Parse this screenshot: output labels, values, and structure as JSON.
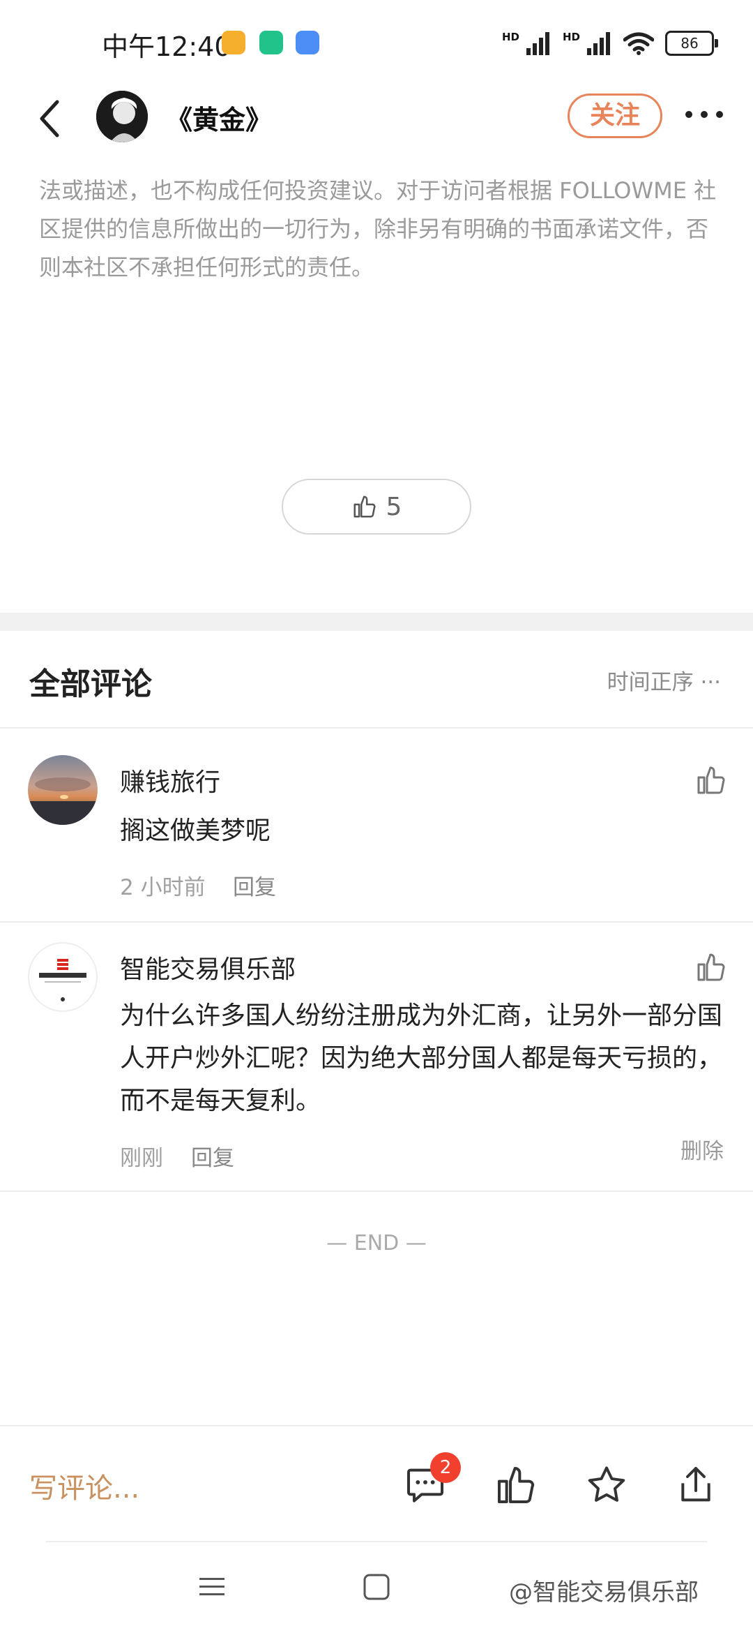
{
  "status_bar": {
    "time": "中午12:40",
    "hd_1": "HD",
    "hd_2": "HD",
    "battery": "86"
  },
  "header": {
    "title": "《黄金》",
    "follow_label": "关注"
  },
  "article": {
    "disclaimer": "法或描述，也不构成任何投资建议。对于访问者根据 FOLLOWME 社区提供的信息所做出的一切行为，除非另有明确的书面承诺文件，否则本社区不承担任何形式的责任。",
    "like_count": "5"
  },
  "comments": {
    "title": "全部评论",
    "sort_label": "时间正序",
    "items": [
      {
        "name": "赚钱旅行",
        "text": "搁这做美梦呢",
        "time": "2 小时前",
        "reply_label": "回复"
      },
      {
        "name": "智能交易俱乐部",
        "text": "为什么许多国人纷纷注册成为外汇商，让另外一部分国人开户炒外汇呢？因为绝大部分国人都是每天亏损的，而不是每天复利。",
        "time": "刚刚",
        "reply_label": "回复",
        "delete_label": "删除"
      }
    ],
    "end_label": "— END —"
  },
  "bottom_bar": {
    "write_placeholder": "写评论...",
    "comment_badge": "2"
  },
  "watermark": "@智能交易俱乐部",
  "colors": {
    "accent": "#e8845a",
    "write_text": "#c8915f",
    "badge": "#f2402e"
  },
  "icons": [
    "back-icon",
    "more-icon",
    "thumb-up-icon",
    "comment-icon",
    "star-icon",
    "share-icon",
    "menu-icon",
    "home-icon"
  ]
}
